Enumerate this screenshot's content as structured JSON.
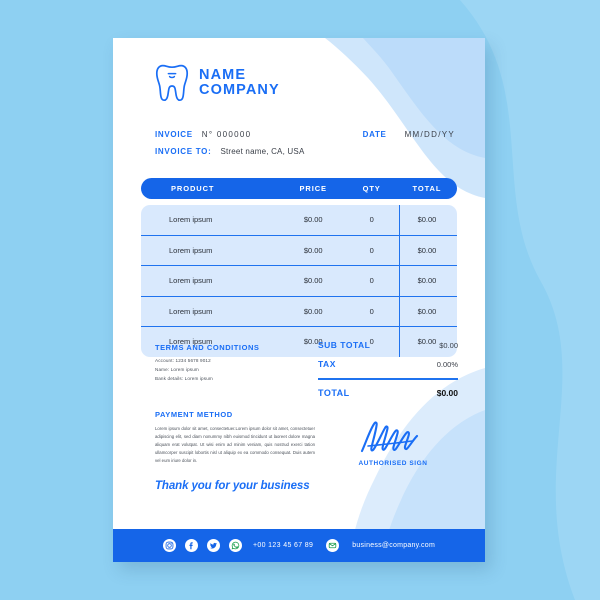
{
  "theme": {
    "page_background": "#8ed0f2",
    "card_background": "#ffffff",
    "primary_blue": "#1565e8",
    "accent_blue": "#1a6ef5",
    "row_background": "#d9e9fd",
    "text_dark": "#2b3038"
  },
  "logo": {
    "icon": "tooth-icon",
    "line1": "NAME",
    "line2": "COMPANY"
  },
  "meta": {
    "invoice_label": "INVOICE",
    "invoice_number": "N° 000000",
    "date_label": "DATE",
    "date_value": "MM/DD/YY",
    "invoice_to_label": "INVOICE TO:",
    "invoice_to_value": "Street name, CA, USA"
  },
  "table": {
    "headers": [
      "PRODUCT",
      "PRICE",
      "QTY",
      "TOTAL"
    ],
    "rows": [
      {
        "product": "Lorem ipsum",
        "price": "$0.00",
        "qty": "0",
        "total": "$0.00"
      },
      {
        "product": "Lorem ipsum",
        "price": "$0.00",
        "qty": "0",
        "total": "$0.00"
      },
      {
        "product": "Lorem ipsum",
        "price": "$0.00",
        "qty": "0",
        "total": "$0.00"
      },
      {
        "product": "Lorem ipsum",
        "price": "$0.00",
        "qty": "0",
        "total": "$0.00"
      },
      {
        "product": "Lorem ipsum",
        "price": "$0.00",
        "qty": "0",
        "total": "$0.00"
      }
    ]
  },
  "terms": {
    "title": "TERMS AND CONDITIONS",
    "lines": [
      "Account: 1234 5678 9012",
      "Name: Lorem ipsum",
      "Bank details: Lorem ipsum"
    ]
  },
  "totals": {
    "sub_total_label": "SUB TOTAL",
    "sub_total_value": "$0.00",
    "tax_label": "TAX",
    "tax_value": "0.00%",
    "total_label": "TOTAL",
    "total_value": "$0.00"
  },
  "payment": {
    "title": "PAYMENT METHOD",
    "body": "Lorem ipsum dolor sit amet, consectetuer.Lorem ipsum dolor sit amet, consectetuer adipiscing elit, sed diam nonummy nibh euismod tincidunt ut laoreet dolore magna aliquam erat volutpat. Ut wisi enim ad minim veniam, quis nostrud exerci tation ullamcorper suscipit lobortis nisl ut aliquip ex ea commodo consequat. Duis autem vel eum iriure dolor in."
  },
  "signature": {
    "label": "AUTHORISED SIGN",
    "mark": "handwritten-signature"
  },
  "thanks": "Thank you for your business",
  "footer": {
    "social": [
      {
        "name": "instagram-icon"
      },
      {
        "name": "facebook-icon"
      },
      {
        "name": "twitter-icon"
      },
      {
        "name": "whatsapp-icon"
      }
    ],
    "phone": "+00 123 45 67 89",
    "email_icon": "email-icon",
    "email": "business@company.com"
  }
}
